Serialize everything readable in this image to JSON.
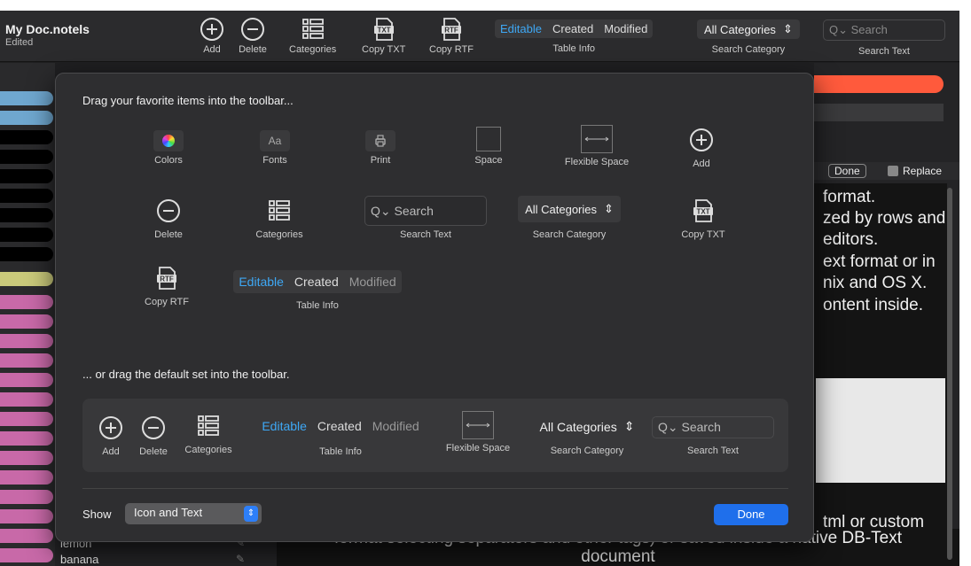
{
  "window": {
    "doc_title": "My Doc.notels",
    "doc_status": "Edited"
  },
  "toolbar": {
    "add": "Add",
    "delete": "Delete",
    "categories": "Categories",
    "copy_txt": "Copy TXT",
    "copy_rtf": "Copy RTF",
    "table_info": {
      "editable": "Editable",
      "created": "Created",
      "modified": "Modified",
      "label": "Table Info"
    },
    "search_category": {
      "value": "All Categories",
      "label": "Search Category"
    },
    "search_text": {
      "placeholder": "Search",
      "label": "Search Text"
    }
  },
  "sheet": {
    "heading": "Drag your favorite items into the toolbar...",
    "items": {
      "colors": "Colors",
      "fonts": "Fonts",
      "fonts_glyph": "Aa",
      "print": "Print",
      "space": "Space",
      "flexible_space": "Flexible Space",
      "add": "Add",
      "delete": "Delete",
      "categories": "Categories",
      "search_text_placeholder": "Search",
      "search_text": "Search Text",
      "search_category_value": "All Categories",
      "search_category": "Search Category",
      "copy_txt": "Copy TXT",
      "copy_rtf": "Copy RTF",
      "table_info_editable": "Editable",
      "table_info_created": "Created",
      "table_info_modified": "Modified",
      "table_info": "Table Info"
    },
    "default_heading": "... or drag the default set into the toolbar.",
    "default_set": {
      "add": "Add",
      "delete": "Delete",
      "categories": "Categories",
      "editable": "Editable",
      "created": "Created",
      "modified": "Modified",
      "table_info": "Table Info",
      "flexible_space": "Flexible Space",
      "search_category_value": "All Categories",
      "search_category": "Search Category",
      "search_placeholder": "Search",
      "search_text": "Search Text"
    },
    "show_label": "Show",
    "show_value": "Icon and Text",
    "done": "Done"
  },
  "find_bar": {
    "done": "Done",
    "replace": "Replace"
  },
  "content_lines": [
    "format.",
    "zed by rows and",
    "editors.",
    "ext format or in",
    "nix and OS X.",
    "ontent inside.",
    "tml or custom"
  ],
  "bottom_text": [
    "format selecting separators and other tags) or saved inside a native DB-Text",
    "document"
  ],
  "list": [
    "lemon",
    "banana"
  ],
  "colors": {
    "accent": "#3ea8f5",
    "done": "#1f6feb",
    "orange": "#ff5a3c"
  }
}
